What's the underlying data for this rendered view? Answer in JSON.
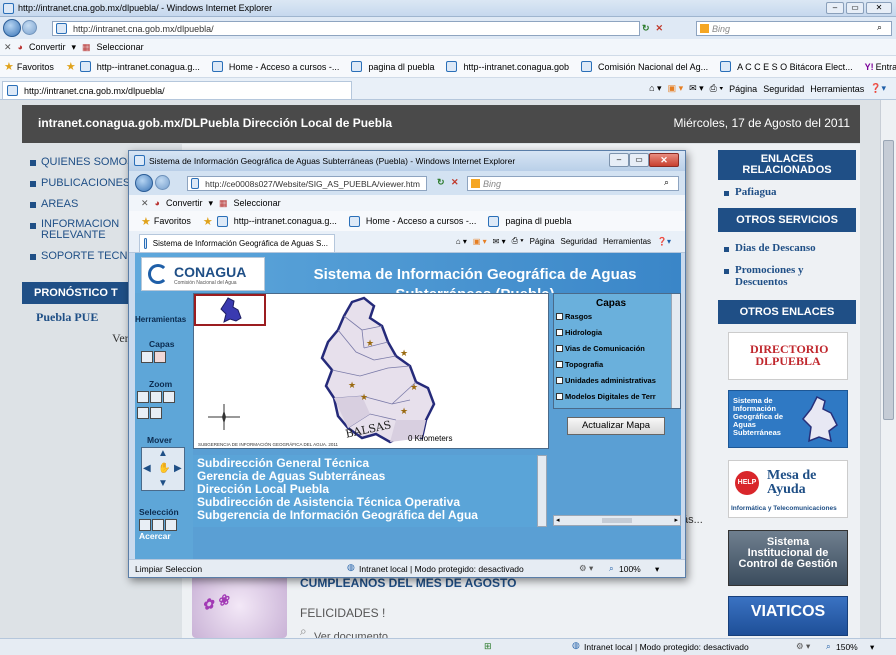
{
  "outer_window": {
    "title": "http://intranet.cna.gob.mx/dlpuebla/ - Windows Internet Explorer",
    "address": "http://intranet.cna.gob.mx/dlpuebla/",
    "search_placeholder": "Bing",
    "convert_label": "Convertir",
    "select_label": "Seleccionar",
    "favorites_label": "Favoritos",
    "favorites": [
      "http--intranet.conagua.g...",
      "Home - Acceso a cursos -...",
      "pagina dl puebla",
      "http--intranet.conagua.gob",
      "Comisión Nacional del Ag...",
      "A C C E S O  Bitácora Elect...",
      "Entrar en Yahoo!"
    ],
    "tab_title": "http://intranet.cna.gob.mx/dlpuebla/",
    "cmd_items": [
      "Página",
      "Seguridad",
      "Herramientas"
    ],
    "status_text": "Intranet local | Modo protegido: desactivado",
    "zoom": "150%"
  },
  "site": {
    "header_left": "intranet.conagua.gob.mx/DLPuebla  Dirección Local de Puebla",
    "header_right": "Miércoles, 17 de Agosto del 2011",
    "left_menu": [
      "QUIENES SOMOS",
      "PUBLICACIONES",
      "AREAS",
      "INFORMACION RELEVANTE",
      "SOPORTE TECNICO"
    ],
    "pronostico": "PRONÓSTICO T",
    "puebla": "Puebla PUE",
    "ver": "Ver",
    "cumple": "CUMPLEAÑOS DEL MES DE AGOSTO",
    "felicidades": "FELICIDADES !",
    "ver_documento": "Ver documento",
    "right_enlaces_head": "ENLACES RELACIONADOS",
    "right_enlaces": [
      "Pafiagua"
    ],
    "right_otros_head": "OTROS SERVICIOS",
    "right_otros": [
      "Dias de Descanso",
      "Promociones y Descuentos"
    ],
    "right_otros_enlaces_head": "OTROS ENLACES",
    "directorio": "DIRECTORIO DLPUEBLA",
    "sigas_banner": "Sistema de Información Geográfica de Aguas Subterráneas",
    "mesa": "Mesa de Ayuda",
    "mesa_sub": "Informática y Telecomunicaciones",
    "sicg": "Sistema Institucional de Control de Gestión",
    "viaticos": "VIATICOS",
    "ellipsis": "ás..."
  },
  "popup": {
    "title": "Sistema de Información Geográfica de Aguas Subterráneas (Puebla) - Windows Internet Explorer",
    "address": "http://ce0008s027/Website/SIG_AS_PUEBLA/viewer.htm",
    "search_placeholder": "Bing",
    "convert_label": "Convertir",
    "select_label": "Seleccionar",
    "favorites_label": "Favoritos",
    "favorites": [
      "http--intranet.conagua.g...",
      "Home - Acceso a cursos -...",
      "pagina dl puebla"
    ],
    "tab_title": "Sistema de Información Geográfica de Aguas S...",
    "cmd_items": [
      "Página",
      "Seguridad",
      "Herramientas"
    ],
    "logo": "CONAGUA",
    "logo_sub": "Comisión Nacional del Agua",
    "app_title": "Sistema de Información Geográfica de Aguas Subterráneas (Puebla)",
    "herramientas": "Herramientas",
    "capas_label": "Capas",
    "zoom_label": "Zoom",
    "mover_label": "Mover",
    "seleccion_label": "Selección",
    "acercar": "Acercar",
    "map_label": "BALSAS",
    "scale": "0 Kilometers",
    "credit": "SUBGERENCIA DE INFORMACIÓN GEOGRÁFICA DEL AGUA. 2011",
    "layers_title": "Capas",
    "layers": [
      "Rasgos",
      "Hidrologia",
      "Vias de Comunicación",
      "Topografia",
      "Unidades administrativas",
      "Modelos Digitales de Terr"
    ],
    "update_button": "Actualizar Mapa",
    "subdirs": [
      "Subdirección General Técnica",
      "Gerencia de Aguas Subterráneas",
      "Dirección Local Puebla",
      "Subdirección de Asistencia Técnica Operativa",
      "Subgerencia de Información Geográfica del Agua"
    ],
    "status_left": "Limpiar Seleccion",
    "status_text": "Intranet local | Modo protegido: desactivado",
    "zoom": "100%"
  }
}
